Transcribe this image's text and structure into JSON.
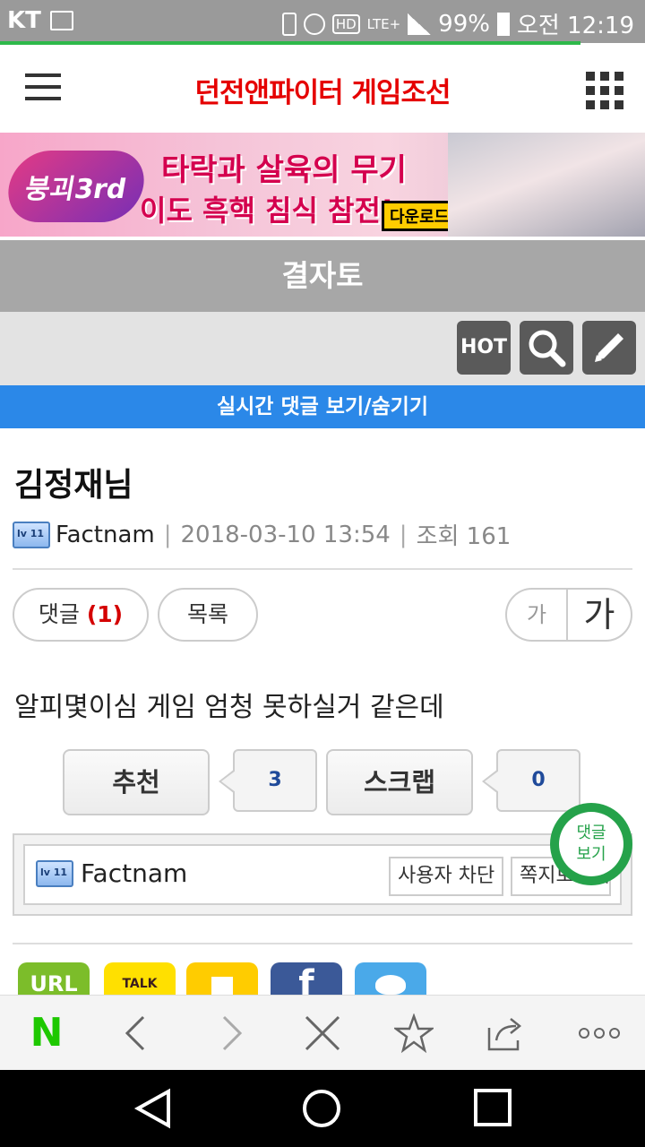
{
  "status": {
    "carrier": "KT",
    "battery": "99%",
    "time": "오전 12:19",
    "network": "LTE+",
    "hd": "HD"
  },
  "header": {
    "title": "던전앤파이터 게임조선"
  },
  "banner": {
    "line1": "타락과 살육의 무기",
    "line2": "이도 흑핵 침식 참전!",
    "download": "다운로드",
    "logo_text": "붕괴3rd"
  },
  "board": {
    "name": "결자토"
  },
  "toolbar": {
    "hot": "HOT"
  },
  "live_comments": "실시간 댓글 보기/숨기기",
  "post": {
    "title": "김정재님",
    "author": "Factnam",
    "date": "2018-03-10 13:54",
    "views_label": "조회 161",
    "body": "알피몇이심 게임 엄청 못하실거 같은데",
    "level_icon": "lv 11"
  },
  "actions": {
    "comments_label": "댓글",
    "comments_count": "(1)",
    "list": "목록",
    "font_small": "가",
    "font_big": "가"
  },
  "votes": {
    "recommend": "추천",
    "recommend_count": "3",
    "scrap": "스크랩",
    "scrap_count": "0"
  },
  "user": {
    "name": "Factnam",
    "block": "사용자 차단",
    "message": "쪽지보내기"
  },
  "floating": {
    "line1": "댓글",
    "line2": "보기"
  },
  "share": {
    "url": "URL",
    "talk": "TALK",
    "facebook": "f"
  },
  "colors": {
    "accent": "#2b88e8",
    "title": "#e50000",
    "green": "#25a24a"
  }
}
